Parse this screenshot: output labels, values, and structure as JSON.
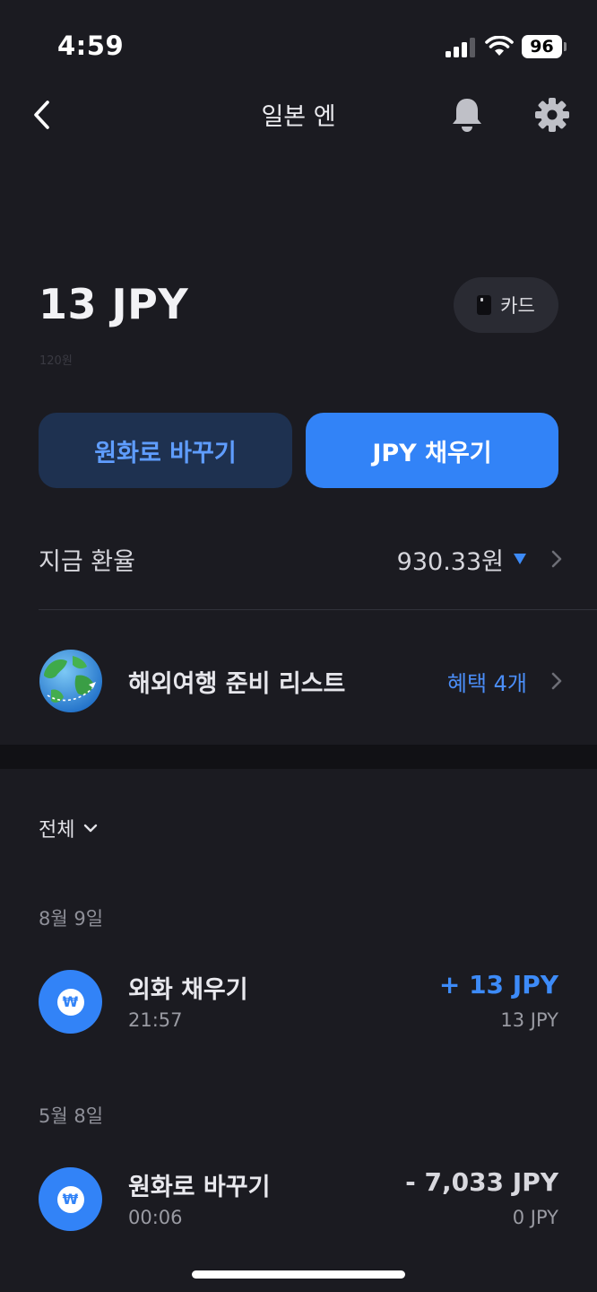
{
  "status_bar": {
    "time": "4:59",
    "battery": "96"
  },
  "nav": {
    "title": "일본 엔"
  },
  "balance": {
    "amount": "13 JPY",
    "krw_value": "120원"
  },
  "card_button": {
    "label": "카드"
  },
  "actions": {
    "convert_label": "원화로 바꾸기",
    "charge_label": "JPY 채우기"
  },
  "rate": {
    "label": "지금 환율",
    "value": "930.33원",
    "trend": "down",
    "trend_color": "#3d8bf8"
  },
  "travel": {
    "label": "해외여행 준비 리스트",
    "benefit": "혜택 4개"
  },
  "filter": {
    "label": "전체"
  },
  "transactions": [
    {
      "date": "8월 9일",
      "title": "외화 채우기",
      "time": "21:57",
      "amount": "+ 13 JPY",
      "balance": "13 JPY",
      "icon": "won-icon"
    },
    {
      "date": "5월 8일",
      "title": "원화로 바꾸기",
      "time": "00:06",
      "amount": "- 7,033 JPY",
      "balance": "0 JPY",
      "icon": "won-icon"
    }
  ],
  "colors": {
    "background": "#1b1b21",
    "accent": "#3283f7",
    "accent_text": "#4b8ef8"
  }
}
